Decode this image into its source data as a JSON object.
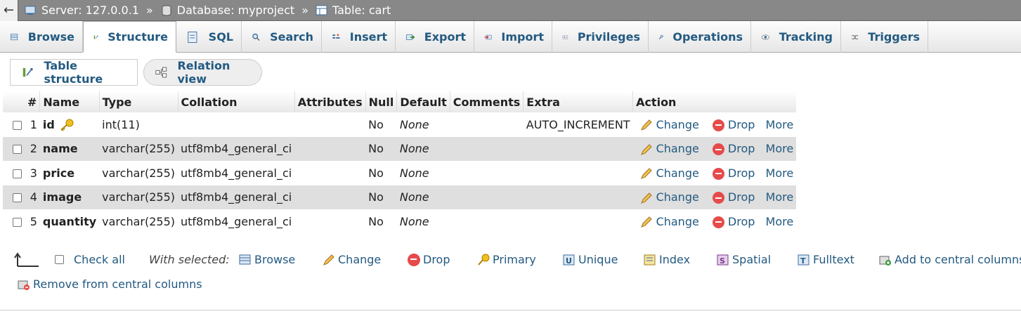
{
  "breadcrumb": {
    "back_glyph": "←",
    "server": "Server: 127.0.0.1",
    "database": "Database: myproject",
    "table": "Table: cart",
    "sep": "»"
  },
  "tabs": [
    {
      "label": "Browse"
    },
    {
      "label": "Structure",
      "active": true
    },
    {
      "label": "SQL"
    },
    {
      "label": "Search"
    },
    {
      "label": "Insert"
    },
    {
      "label": "Export"
    },
    {
      "label": "Import"
    },
    {
      "label": "Privileges"
    },
    {
      "label": "Operations"
    },
    {
      "label": "Tracking"
    },
    {
      "label": "Triggers"
    }
  ],
  "subtabs": {
    "table_structure": "Table structure",
    "relation_view": "Relation view"
  },
  "columns": {
    "num": "#",
    "name": "Name",
    "type": "Type",
    "collation": "Collation",
    "attributes": "Attributes",
    "null": "Null",
    "default": "Default",
    "comments": "Comments",
    "extra": "Extra",
    "action": "Action"
  },
  "rows": [
    {
      "num": "1",
      "name": "id",
      "type": "int(11)",
      "collation": "",
      "null": "No",
      "default": "None",
      "extra": "AUTO_INCREMENT",
      "primary_key": true
    },
    {
      "num": "2",
      "name": "name",
      "type": "varchar(255)",
      "collation": "utf8mb4_general_ci",
      "null": "No",
      "default": "None",
      "extra": ""
    },
    {
      "num": "3",
      "name": "price",
      "type": "varchar(255)",
      "collation": "utf8mb4_general_ci",
      "null": "No",
      "default": "None",
      "extra": ""
    },
    {
      "num": "4",
      "name": "image",
      "type": "varchar(255)",
      "collation": "utf8mb4_general_ci",
      "null": "No",
      "default": "None",
      "extra": ""
    },
    {
      "num": "5",
      "name": "quantity",
      "type": "varchar(255)",
      "collation": "utf8mb4_general_ci",
      "null": "No",
      "default": "None",
      "extra": ""
    }
  ],
  "row_actions": {
    "change": "Change",
    "drop": "Drop",
    "more": "More"
  },
  "bottom": {
    "check_all": "Check all",
    "with_selected": "With selected:",
    "browse": "Browse",
    "change": "Change",
    "drop": "Drop",
    "primary": "Primary",
    "unique": "Unique",
    "index": "Index",
    "spatial": "Spatial",
    "fulltext": "Fulltext",
    "add_central": "Add to central columns",
    "remove_central": "Remove from central columns"
  },
  "colors": {
    "link": "#235a81",
    "drop_red": "#e54b4b",
    "row_alt": "#dfdfdf",
    "crumb_bg": "#888888"
  }
}
